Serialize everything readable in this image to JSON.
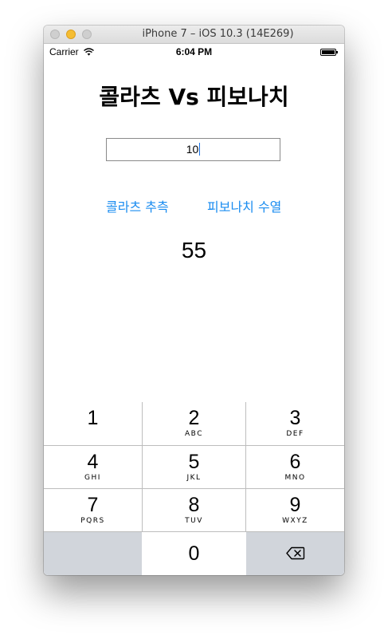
{
  "window": {
    "title": "iPhone 7 – iOS 10.3 (14E269)"
  },
  "status_bar": {
    "carrier": "Carrier",
    "time": "6:04 PM"
  },
  "app": {
    "title": "콜라츠 Vs 피보나치",
    "input_value": "10",
    "collatz_button": "콜라츠 추측",
    "fibonacci_button": "피보나치 수열",
    "result": "55"
  },
  "keypad": {
    "keys": [
      {
        "digit": "1",
        "letters": ""
      },
      {
        "digit": "2",
        "letters": "ABC"
      },
      {
        "digit": "3",
        "letters": "DEF"
      },
      {
        "digit": "4",
        "letters": "GHI"
      },
      {
        "digit": "5",
        "letters": "JKL"
      },
      {
        "digit": "6",
        "letters": "MNO"
      },
      {
        "digit": "7",
        "letters": "PQRS"
      },
      {
        "digit": "8",
        "letters": "TUV"
      },
      {
        "digit": "9",
        "letters": "WXYZ"
      },
      {
        "digit": "0",
        "letters": ""
      }
    ],
    "delete_icon": "delete-backspace-icon"
  },
  "colors": {
    "accent": "#1a8cf0",
    "keypad_gray": "#d1d5db",
    "minimize_yellow": "#f5bd32"
  }
}
